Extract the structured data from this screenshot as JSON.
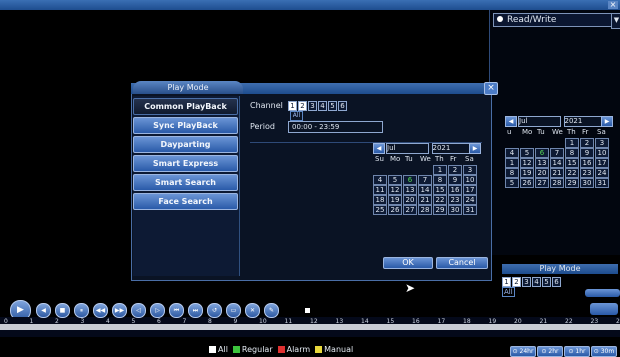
{
  "window": {
    "close_label": "×"
  },
  "right_panel": {
    "mode_select": "Read/Write",
    "calendar": {
      "month": "Jul",
      "year": "2021",
      "dow": [
        "u",
        "Mo",
        "Tu",
        "We",
        "Th",
        "Fr",
        "Sa"
      ],
      "rows": [
        [
          "",
          "",
          "",
          "",
          "1",
          "2",
          "3"
        ],
        [
          "4",
          "5",
          "6",
          "7",
          "8",
          "9",
          "10"
        ],
        [
          "1",
          "12",
          "13",
          "14",
          "15",
          "16",
          "17"
        ],
        [
          "8",
          "19",
          "20",
          "21",
          "22",
          "23",
          "24"
        ],
        [
          "5",
          "26",
          "27",
          "28",
          "29",
          "30",
          "31"
        ]
      ]
    },
    "play_mode_title": "Play Mode",
    "channels": [
      "1",
      "2",
      "3",
      "4",
      "5",
      "6"
    ],
    "all_label": "All"
  },
  "dialog": {
    "title": "Play Mode",
    "close": "×",
    "nav": [
      "Common PlayBack",
      "Sync PlayBack",
      "Dayparting",
      "Smart Express",
      "Smart Search",
      "Face Search"
    ],
    "channel_label": "Channel",
    "channels": [
      "1",
      "2",
      "3",
      "4",
      "5",
      "6"
    ],
    "all_label": "All",
    "period_label": "Period",
    "period_value": "00:00  -  23:59",
    "calendar": {
      "month": "Jul",
      "year": "2021",
      "dow": [
        "Su",
        "Mo",
        "Tu",
        "We",
        "Th",
        "Fr",
        "Sa"
      ],
      "rows": [
        [
          "",
          "",
          "",
          "",
          "1",
          "2",
          "3"
        ],
        [
          "4",
          "5",
          "6",
          "7",
          "8",
          "9",
          "10"
        ],
        [
          "11",
          "12",
          "13",
          "14",
          "15",
          "16",
          "17"
        ],
        [
          "18",
          "19",
          "20",
          "21",
          "22",
          "23",
          "24"
        ],
        [
          "25",
          "26",
          "27",
          "28",
          "29",
          "30",
          "31"
        ]
      ],
      "highlight": "6"
    },
    "ok": "OK",
    "cancel": "Cancel"
  },
  "timeline": {
    "ticks": [
      "0",
      "1",
      "2",
      "3",
      "4",
      "5",
      "6",
      "7",
      "8",
      "9",
      "10",
      "11",
      "12",
      "13",
      "14",
      "15",
      "16",
      "17",
      "18",
      "19",
      "20",
      "21",
      "22",
      "23",
      "24"
    ],
    "legend": [
      {
        "label": "All",
        "color": "#ffffff"
      },
      {
        "label": "Regular",
        "color": "#3cc43c"
      },
      {
        "label": "Alarm",
        "color": "#e03030"
      },
      {
        "label": "Manual",
        "color": "#e8d83c"
      }
    ],
    "zoom": [
      "24hr",
      "2hr",
      "1hr",
      "30m"
    ]
  },
  "colors": {
    "accent": "#2a5aa8",
    "highlight_day": "#57d957"
  }
}
